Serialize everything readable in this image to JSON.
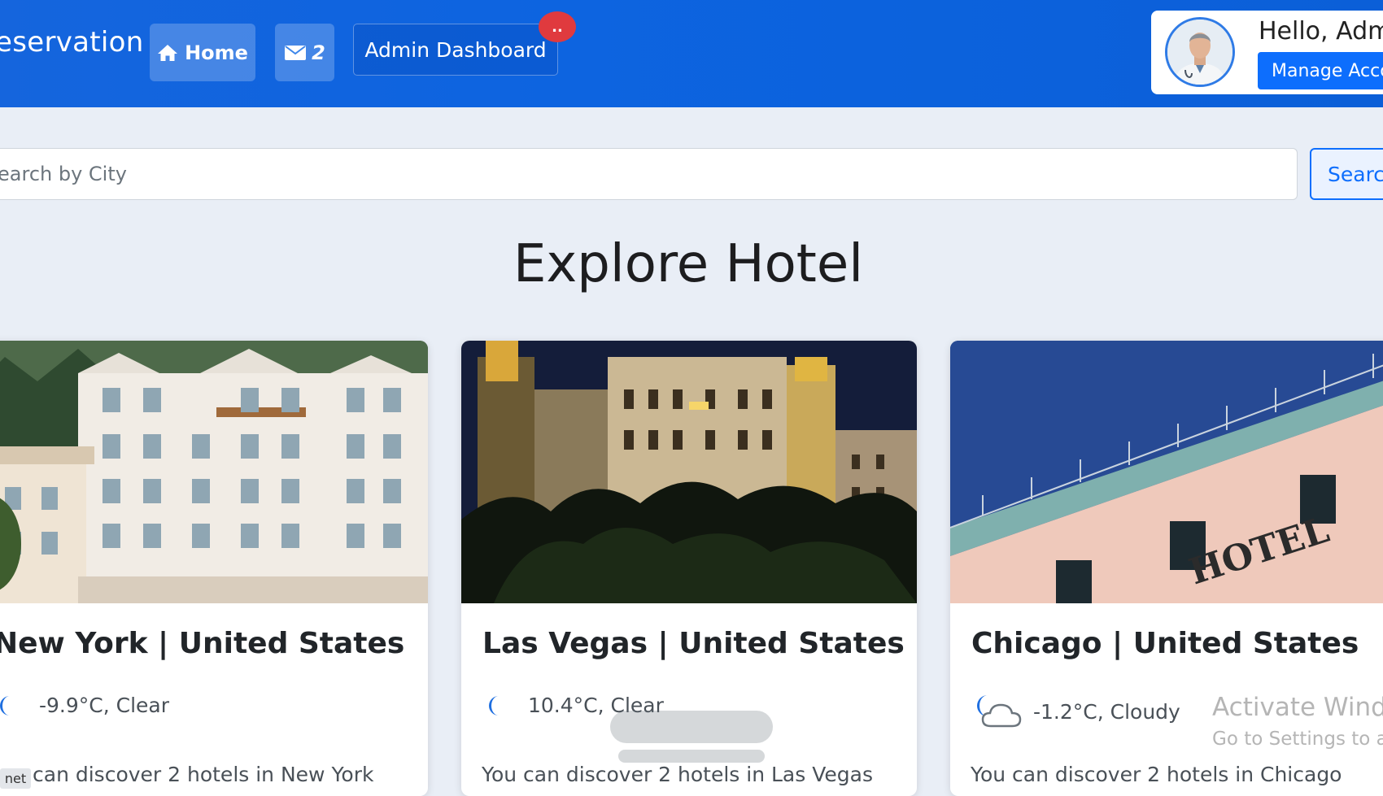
{
  "header": {
    "brand": "eservation",
    "home_label": "Home",
    "message_count": "2",
    "admin_label": "Admin Dashboard",
    "admin_badge": "..",
    "greeting": "Hello, Adm",
    "manage_label": "Manage Acco"
  },
  "search": {
    "placeholder": "earch by City",
    "button_label": "Search"
  },
  "page": {
    "title": "Explore Hotel"
  },
  "cards": [
    {
      "title": "New York | United States",
      "weather_icon": "moon-icon",
      "weather": "-9.9°C, Clear",
      "discover": "can discover 2 hotels in New York"
    },
    {
      "title": "Las Vegas | United States",
      "weather_icon": "moon-icon",
      "weather": "10.4°C, Clear",
      "discover": "You can discover 2 hotels in Las Vegas"
    },
    {
      "title": "Chicago | United States",
      "weather_icon": "cloudy-night-icon",
      "weather": "-1.2°C, Cloudy",
      "discover": "You can discover 2 hotels in Chicago"
    }
  ],
  "tag": "net",
  "sign_text": "HOTEL",
  "os_notice": {
    "title": "Activate Windo",
    "subtitle": "Go to Settings to ac"
  },
  "colors": {
    "navbar": "#0d64e0",
    "primary": "#0d6efd",
    "badge": "#e03a3e",
    "page_bg": "#e9eef6"
  }
}
